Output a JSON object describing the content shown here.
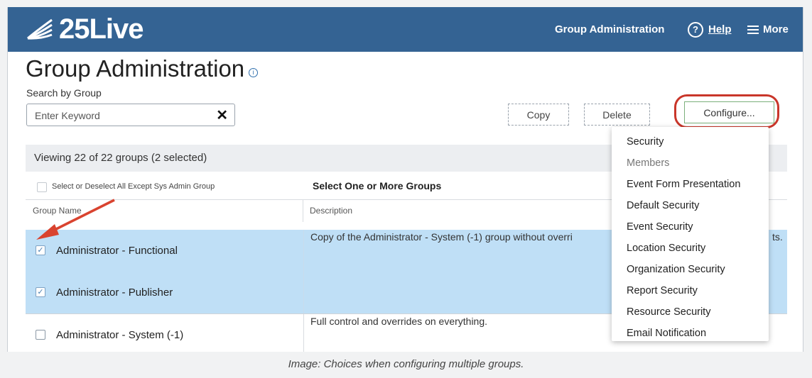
{
  "header": {
    "logo_text": "25Live",
    "nav_group_admin": "Group Administration",
    "nav_help": "Help",
    "nav_help_icon": "?",
    "nav_more": "More",
    "colors": {
      "bar": "#346393"
    }
  },
  "page": {
    "title": "Group Administration",
    "info_icon": "i",
    "search_label": "Search by Group",
    "search_placeholder": "Enter Keyword",
    "clear_symbol": "✕"
  },
  "toolbar": {
    "copy_label": "Copy",
    "delete_label": "Delete",
    "configure_label": "Configure..."
  },
  "listing": {
    "viewing_text": "Viewing 22 of 22 groups (2 selected)",
    "select_all_label": "Select or Deselect All Except Sys Admin Group",
    "select_heading": "Select One or More Groups",
    "columns": {
      "name": "Group Name",
      "description": "Description"
    },
    "rows": [
      {
        "name": "Administrator - Functional",
        "checked": true,
        "description": "Copy of the Administrator - System (-1) group without overri",
        "description_tail": "ts."
      },
      {
        "name": "Administrator - Publisher",
        "checked": true,
        "description": "",
        "description_tail": ""
      },
      {
        "name": "Administrator - System (-1)",
        "checked": false,
        "description": "Full control and overrides on everything.",
        "description_tail": ""
      }
    ],
    "check_mark": "✓"
  },
  "configure_menu": {
    "items": [
      "Security",
      "Members",
      "Event Form Presentation",
      "Default Security",
      "Event Security",
      "Location Security",
      "Organization Security",
      "Report Security",
      "Resource Security",
      "Email Notification"
    ],
    "disabled_item": "Members"
  },
  "caption": "Image: Choices when configuring multiple groups.",
  "annotation_colors": {
    "arrow": "#d9432f",
    "ring": "#c9362a"
  }
}
